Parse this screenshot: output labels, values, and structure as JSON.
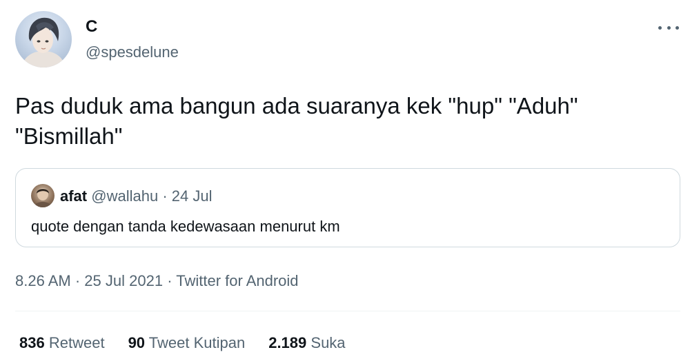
{
  "author": {
    "display_name": "C",
    "handle": "@spesdelune",
    "avatar_icon": "anime-avatar"
  },
  "more_icon": "more-dots-icon",
  "tweet_text": "Pas duduk ama bangun ada suaranya kek \"hup\" \"Aduh\"\n\"Bismillah\"",
  "quote": {
    "name": "afat",
    "handle": "@wallahu",
    "separator": "·",
    "date": "24 Jul",
    "text": "quote dengan tanda kedewasaan menurut km"
  },
  "timestamp": {
    "time": "8.26 AM",
    "sep1": "·",
    "date": "25 Jul 2021",
    "sep2": "·",
    "source": "Twitter for Android"
  },
  "stats": {
    "retweets_count": "836",
    "retweets_label": "Retweet",
    "quotes_count": "90",
    "quotes_label": "Tweet Kutipan",
    "likes_count": "2.189",
    "likes_label": "Suka"
  },
  "colors": {
    "text_primary": "#0f1419",
    "text_secondary": "#536471",
    "border": "#cfd9de"
  }
}
